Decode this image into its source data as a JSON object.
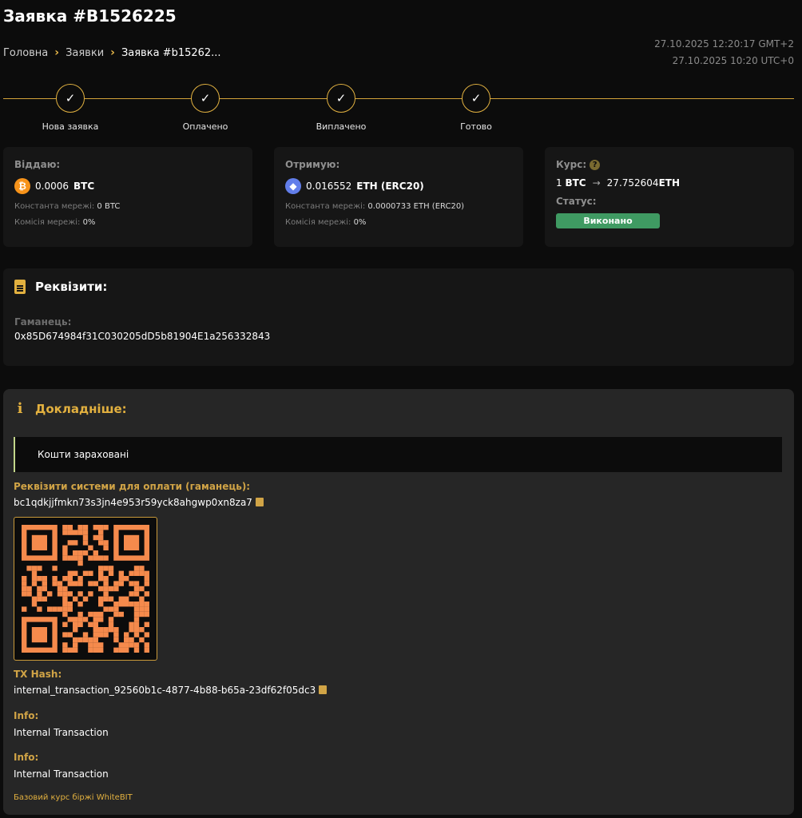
{
  "header": {
    "title": "Заявка #B1526225",
    "breadcrumb": [
      "Головна",
      "Заявки",
      "Заявка #b15262..."
    ],
    "time_local": "27.10.2025 12:20:17 GMT+2",
    "time_utc": "27.10.2025 10:20 UTC+0"
  },
  "steps": [
    {
      "label": "Нова заявка"
    },
    {
      "label": "Оплачено"
    },
    {
      "label": "Виплачено"
    },
    {
      "label": "Готово"
    }
  ],
  "give": {
    "label": "Віддаю:",
    "amount": "0.0006",
    "currency": "BTC",
    "const_label": "Константа мережі:",
    "const_value": "0 BTC",
    "fee_label": "Комісія мережі:",
    "fee_value": "0%"
  },
  "receive": {
    "label": "Отримую:",
    "amount": "0.016552",
    "currency": "ETH (ERC20)",
    "const_label": "Константа мережі:",
    "const_value": "0.0000733 ETH (ERC20)",
    "fee_label": "Комісія мережі:",
    "fee_value": "0%"
  },
  "rate": {
    "label": "Курс:",
    "from_amount": "1",
    "from_currency": "BTC",
    "to_amount": "27.752604",
    "to_currency": "ETH",
    "status_label": "Статус:",
    "status_value": "Виконано"
  },
  "requisites": {
    "title": "Реквізити:",
    "wallet_label": "Гаманець:",
    "wallet_value": "0x85D674984f31C030205dD5b81904E1a256332843"
  },
  "details": {
    "title": "Докладніше:",
    "notice": "Кошти зараховані",
    "pay_label": "Реквізити системи для оплати (гаманець):",
    "pay_address": "bc1qdkjjfmkn73s3jn4e953r59yck8ahgwp0xn8za7",
    "tx_label": "TX Hash:",
    "tx_value": "internal_transaction_92560b1c-4877-4b88-b65a-23df62f05dc3",
    "info1_label": "Info:",
    "info1_value": "Internal Transaction",
    "info2_label": "Info:",
    "info2_value": "Internal Transaction",
    "footer_note": "Базовий курс біржі WhiteBIT"
  },
  "colors": {
    "accent": "#e2b03f",
    "success": "#3f9a62",
    "qr": "#f58a4c"
  }
}
